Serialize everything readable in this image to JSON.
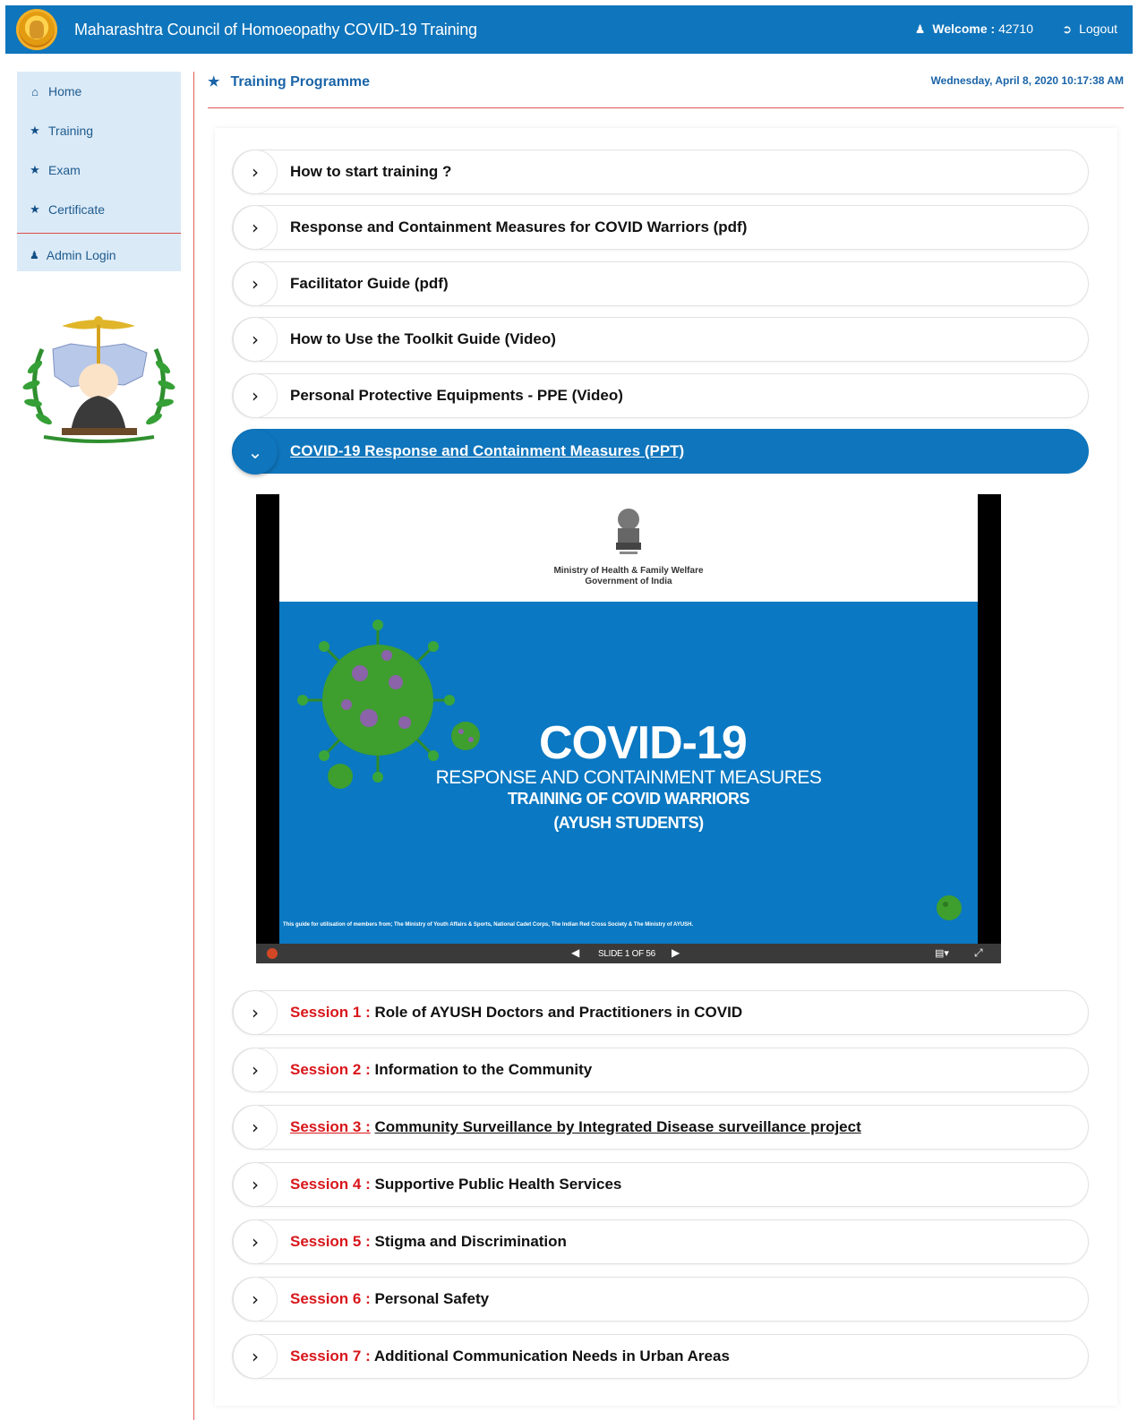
{
  "header": {
    "title": "Maharashtra Council of Homoeopathy COVID-19 Training",
    "welcome_label": "Welcome :",
    "welcome_user": "42710",
    "logout_label": "Logout"
  },
  "sidebar": {
    "items": [
      {
        "label": "Home",
        "icon": "home-icon"
      },
      {
        "label": "Training",
        "icon": "star-icon"
      },
      {
        "label": "Exam",
        "icon": "star-icon"
      },
      {
        "label": "Certificate",
        "icon": "star-icon"
      }
    ],
    "admin_label": "Admin Login"
  },
  "page": {
    "heading": "Training Programme",
    "datetime": "Wednesday, April 8, 2020 10:17:38 AM"
  },
  "accordion": {
    "items": [
      {
        "title": "How to start training ?"
      },
      {
        "title": "Response and Containment Measures for COVID Warriors (pdf)"
      },
      {
        "title": "Facilitator Guide (pdf)"
      },
      {
        "title": "How to Use the Toolkit Guide (Video)"
      },
      {
        "title": "Personal Protective Equipments - PPE (Video)"
      },
      {
        "title": "COVID-19 Response and Containment Measures (PPT)",
        "expanded": true
      }
    ],
    "sessions": [
      {
        "prefix": "Session 1 :",
        "title": "Role of AYUSH Doctors and Practitioners in COVID"
      },
      {
        "prefix": "Session 2 :",
        "title": "Information to the Community"
      },
      {
        "prefix": "Session 3 :",
        "title": "Community Surveillance by Integrated Disease surveillance project"
      },
      {
        "prefix": "Session 4 :",
        "title": "Supportive Public Health Services"
      },
      {
        "prefix": "Session 5 :",
        "title": "Stigma and Discrimination"
      },
      {
        "prefix": "Session 6 :",
        "title": "Personal Safety"
      },
      {
        "prefix": "Session 7 :",
        "title": "Additional Communication Needs in Urban Areas"
      }
    ]
  },
  "viewer": {
    "ministry_line1": "Ministry of Health & Family Welfare",
    "ministry_line2": "Government of India",
    "slide_title": "COVID-19",
    "slide_sub1": "RESPONSE AND CONTAINMENT MEASURES",
    "slide_sub2": "TRAINING OF  COVID WARRIORS",
    "slide_sub3": "(AYUSH STUDENTS)",
    "slide_footer": "This guide for utilisation of members from; The Ministry of Youth Affairs & Sports, National Cadet Corps, The Indian Red Cross Society & The Ministry of AYUSH.",
    "slide_counter": "SLIDE 1 OF 56"
  },
  "colors": {
    "primary": "#0f75bc",
    "session_red": "#d8161b",
    "sidebar_bg": "#dbeaf7",
    "divider_red": "#e05858"
  }
}
